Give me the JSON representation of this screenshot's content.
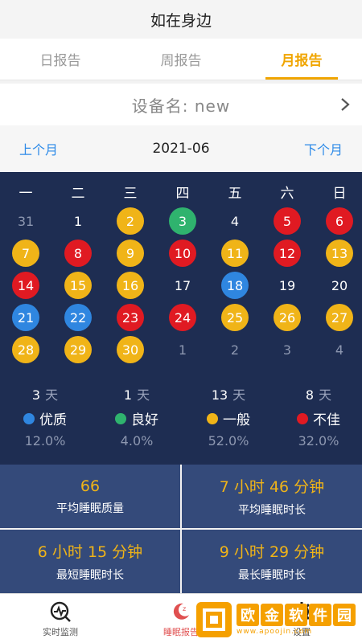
{
  "header": {
    "title": "如在身边"
  },
  "tabs": [
    {
      "label": "日报告",
      "active": false
    },
    {
      "label": "周报告",
      "active": false
    },
    {
      "label": "月报告",
      "active": true
    }
  ],
  "device": {
    "label": "设备名: new"
  },
  "month_nav": {
    "prev": "上个月",
    "current": "2021-06",
    "next": "下个月"
  },
  "calendar": {
    "weekdays": [
      "一",
      "二",
      "三",
      "四",
      "五",
      "六",
      "日"
    ],
    "rows": [
      [
        {
          "d": "31",
          "s": "dim"
        },
        {
          "d": "1",
          "s": "plain"
        },
        {
          "d": "2",
          "s": "yellow"
        },
        {
          "d": "3",
          "s": "green"
        },
        {
          "d": "4",
          "s": "plain"
        },
        {
          "d": "5",
          "s": "red"
        },
        {
          "d": "6",
          "s": "red"
        }
      ],
      [
        {
          "d": "7",
          "s": "yellow"
        },
        {
          "d": "8",
          "s": "red"
        },
        {
          "d": "9",
          "s": "yellow"
        },
        {
          "d": "10",
          "s": "red"
        },
        {
          "d": "11",
          "s": "yellow"
        },
        {
          "d": "12",
          "s": "red"
        },
        {
          "d": "13",
          "s": "yellow"
        }
      ],
      [
        {
          "d": "14",
          "s": "red"
        },
        {
          "d": "15",
          "s": "yellow"
        },
        {
          "d": "16",
          "s": "yellow"
        },
        {
          "d": "17",
          "s": "plain"
        },
        {
          "d": "18",
          "s": "blue"
        },
        {
          "d": "19",
          "s": "plain"
        },
        {
          "d": "20",
          "s": "plain"
        }
      ],
      [
        {
          "d": "21",
          "s": "blue"
        },
        {
          "d": "22",
          "s": "blue"
        },
        {
          "d": "23",
          "s": "red"
        },
        {
          "d": "24",
          "s": "red"
        },
        {
          "d": "25",
          "s": "yellow"
        },
        {
          "d": "26",
          "s": "yellow"
        },
        {
          "d": "27",
          "s": "yellow"
        }
      ],
      [
        {
          "d": "28",
          "s": "yellow"
        },
        {
          "d": "29",
          "s": "yellow"
        },
        {
          "d": "30",
          "s": "yellow"
        },
        {
          "d": "1",
          "s": "dim"
        },
        {
          "d": "2",
          "s": "dim"
        },
        {
          "d": "3",
          "s": "dim"
        },
        {
          "d": "4",
          "s": "dim"
        }
      ]
    ]
  },
  "legend": [
    {
      "days": "3",
      "unit": "天",
      "label": "优质",
      "pct": "12.0%",
      "color": "#2f86e0"
    },
    {
      "days": "1",
      "unit": "天",
      "label": "良好",
      "pct": "4.0%",
      "color": "#2fb36e"
    },
    {
      "days": "13",
      "unit": "天",
      "label": "一般",
      "pct": "52.0%",
      "color": "#f0b418"
    },
    {
      "days": "8",
      "unit": "天",
      "label": "不佳",
      "pct": "32.0%",
      "color": "#e01a22"
    }
  ],
  "stats": [
    {
      "value": "66",
      "caption": "平均睡眠质量"
    },
    {
      "value": "7 小时 46 分钟",
      "caption": "平均睡眠时长"
    },
    {
      "value": "6 小时 15 分钟",
      "caption": "最短睡眠时长"
    },
    {
      "value": "9 小时 29 分钟",
      "caption": "最长睡眠时长"
    }
  ],
  "bottom_nav": [
    {
      "label": "实时监测",
      "icon": "pulse-icon",
      "active": false
    },
    {
      "label": "睡眠报告",
      "icon": "moon-icon",
      "active": true
    },
    {
      "label": "设置",
      "icon": "gear-icon",
      "active": false
    }
  ],
  "watermark": {
    "chars": [
      "欧",
      "金",
      "软",
      "件",
      "园"
    ],
    "url": "www.apoojin.com"
  },
  "colors": {
    "accent": "#f0a500",
    "link": "#2e8be8",
    "panel": "#1e2d52",
    "stat_bg": "#344a7a"
  }
}
